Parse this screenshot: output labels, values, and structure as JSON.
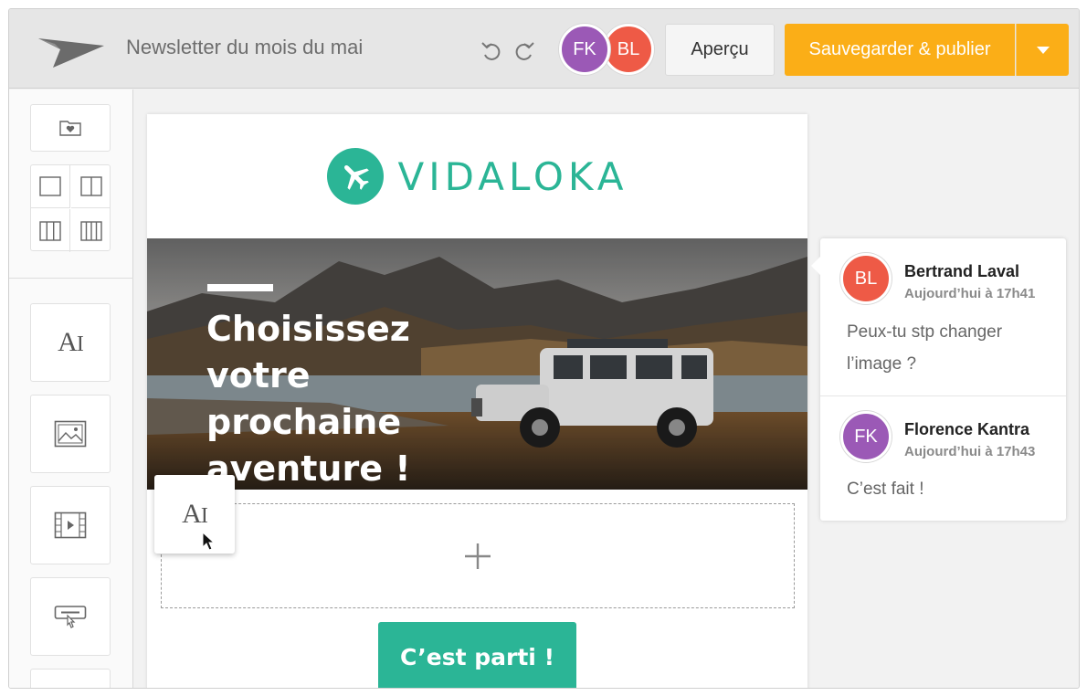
{
  "header": {
    "doc_title": "Newsletter du mois du mai",
    "collaborators": [
      "FK",
      "BL"
    ],
    "preview_label": "Aperçu",
    "publish_label": "Sauvegarder & publier"
  },
  "email": {
    "brand_name": "VIDALOKA",
    "hero_title_lines": [
      "Choisissez",
      "votre prochaine",
      "aventure !"
    ],
    "cta_label": "C’est parti !"
  },
  "comments": [
    {
      "initials": "BL",
      "author": "Bertrand Laval",
      "time": "Aujourd’hui à 17h41",
      "text": "Peux-tu stp changer l’image ?"
    },
    {
      "initials": "FK",
      "author": "Florence Kantra",
      "time": "Aujourd’hui à 17h43",
      "text": "C’est fait !"
    }
  ],
  "colors": {
    "accent_orange": "#fbae17",
    "brand_teal": "#2bb596",
    "avatar_fk": "#9b59b6",
    "avatar_bl": "#ee5a46"
  },
  "icons": [
    "paper-plane-logo-icon",
    "undo-icon",
    "redo-icon",
    "folder-heart-icon",
    "layout-1col-icon",
    "layout-2col-icon",
    "layout-3col-icon",
    "layout-4col-icon",
    "text-block-icon",
    "image-block-icon",
    "video-block-icon",
    "button-block-icon",
    "plus-icon",
    "airplane-icon",
    "cursor-icon"
  ]
}
